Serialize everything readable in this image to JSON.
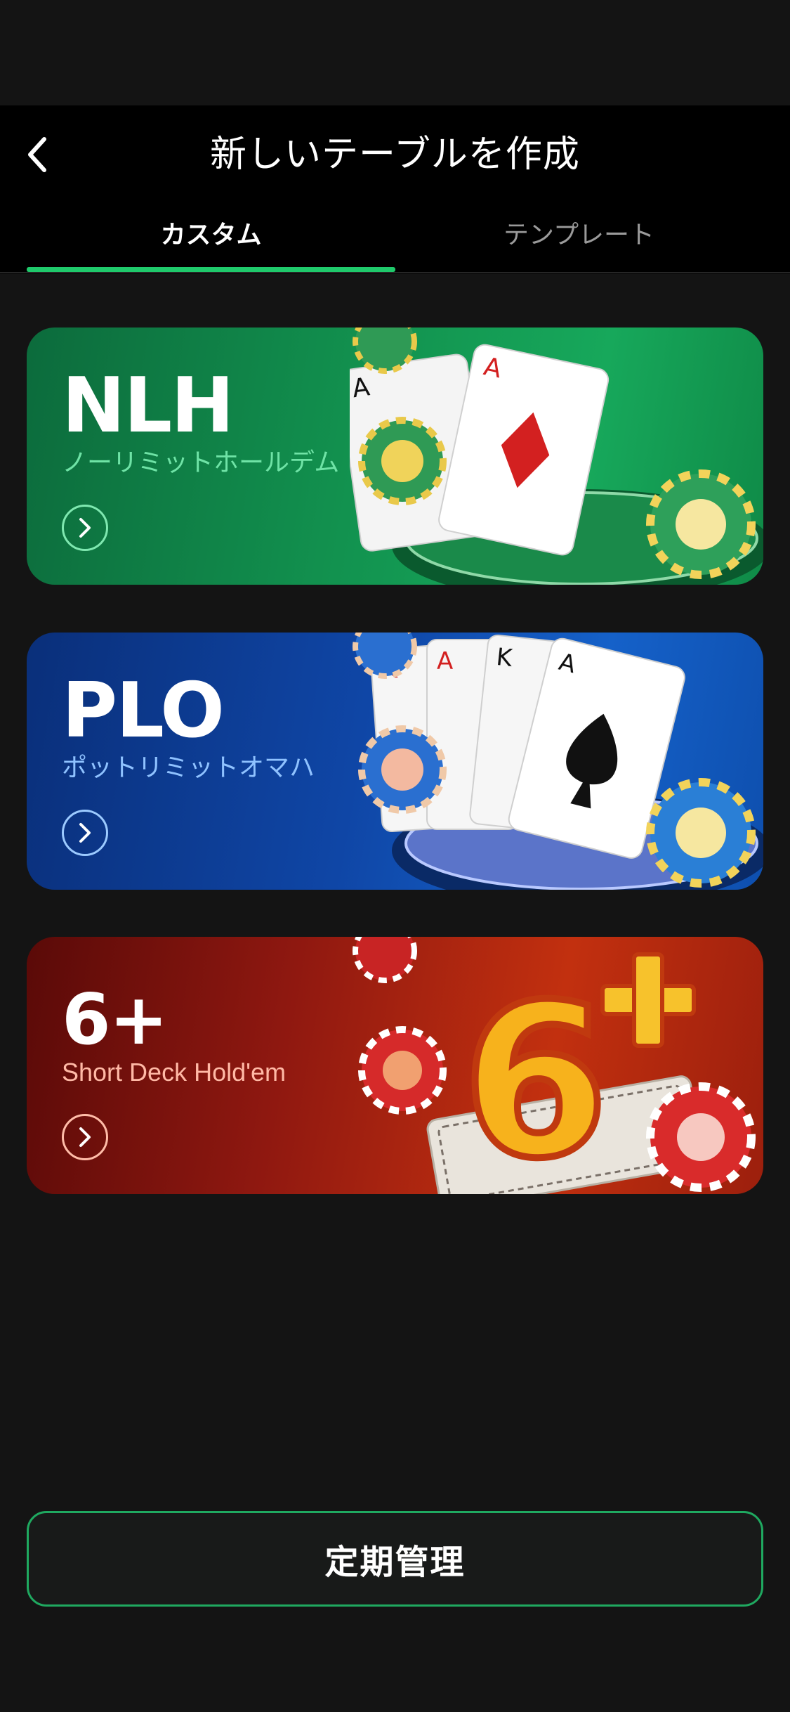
{
  "header": {
    "title": "新しいテーブルを作成",
    "back_icon": "chevron-left-icon"
  },
  "tabs": [
    {
      "label": "カスタム",
      "active": true
    },
    {
      "label": "テンプレート",
      "active": false
    }
  ],
  "colors": {
    "accent": "#1fc96b",
    "background": "#141414",
    "header": "#000000"
  },
  "game_cards": [
    {
      "title": "NLH",
      "subtitle": "ノーリミットホールデム",
      "theme": "green",
      "icon": "chevron-right-icon"
    },
    {
      "title": "PLO",
      "subtitle": "ポットリミットオマハ",
      "theme": "blue",
      "icon": "chevron-right-icon"
    },
    {
      "title": "6+",
      "subtitle": "Short Deck Hold'em",
      "theme": "red",
      "icon": "chevron-right-icon"
    }
  ],
  "footer": {
    "manage_label": "定期管理"
  }
}
